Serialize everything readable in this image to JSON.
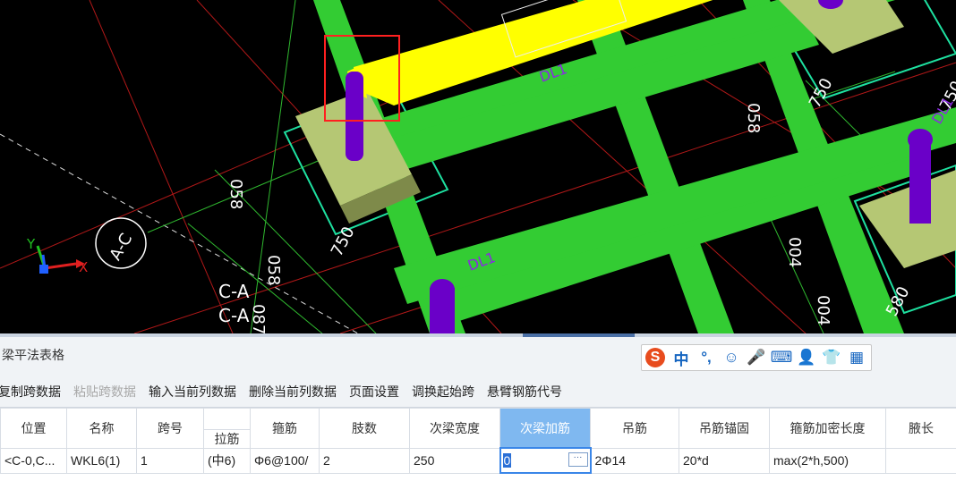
{
  "viewport": {
    "axis_labels": {
      "x": "X",
      "y": "Y"
    },
    "dims": [
      "058",
      "750",
      "058",
      "750",
      "058",
      "004",
      "750",
      "004",
      "580",
      "087"
    ],
    "axis_tag": "A-C",
    "grid_labels": [
      "C-A",
      "C-A"
    ],
    "beam_labels": [
      "DL1",
      "DL1",
      "DL1"
    ]
  },
  "panel": {
    "title": "梁平法表格"
  },
  "ime": {
    "logo": "S",
    "items": [
      "中",
      "°,",
      "☺",
      "🎤",
      "⌨",
      "👤",
      "👕",
      "▦"
    ]
  },
  "toolbar": {
    "items": [
      {
        "label": "复制跨数据",
        "enabled": true
      },
      {
        "label": "粘贴跨数据",
        "enabled": false
      },
      {
        "label": "输入当前列数据",
        "enabled": true
      },
      {
        "label": "删除当前列数据",
        "enabled": true
      },
      {
        "label": "页面设置",
        "enabled": true
      },
      {
        "label": "调换起始跨",
        "enabled": true
      },
      {
        "label": "悬臂钢筋代号",
        "enabled": true
      }
    ]
  },
  "table": {
    "headers": {
      "position": "位置",
      "name": "名称",
      "span": "跨号",
      "tie": "拉筋",
      "stirrup": "箍筋",
      "legs": "肢数",
      "sec_width": "次梁宽度",
      "sec_add": "次梁加筋",
      "hanger": "吊筋",
      "hanger_anchor": "吊筋锚固",
      "dense_len": "箍筋加密长度",
      "haunch": "腋长"
    },
    "row": {
      "position": "<C-0,C...",
      "name": "WKL6(1)",
      "span": "1",
      "tie": "(中6)",
      "stirrup": "Φ6@100/",
      "legs": "2",
      "sec_width": "250",
      "sec_add": "0",
      "hanger": "2Φ14",
      "hanger_anchor": "20*d",
      "dense_len": "max(2*h,500)",
      "haunch": ""
    }
  },
  "colors": {
    "beam": "#33cc33",
    "highlight_beam": "#ffff00",
    "column": "#6a00c8",
    "pad": "#b5c774",
    "active_header": "#7fb8f0",
    "selection_box": "#ff2020"
  }
}
